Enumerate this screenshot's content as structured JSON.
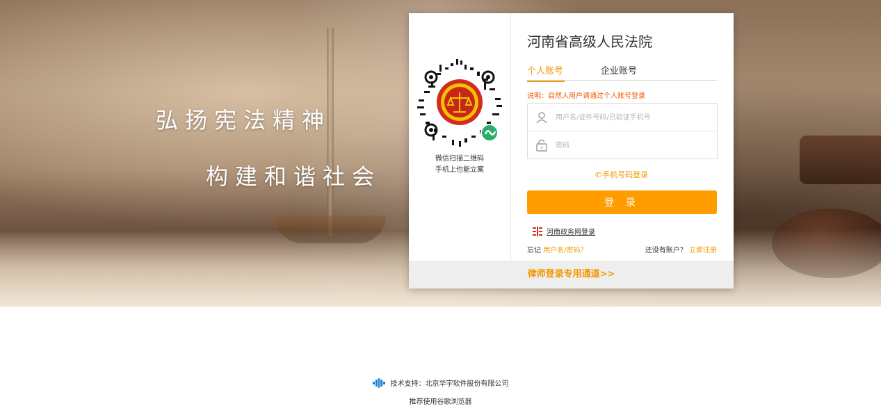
{
  "hero": {
    "slogan_line1": "弘扬宪法精神",
    "slogan_line2": "构建和谐社会"
  },
  "login_panel": {
    "court_name": "河南省高级人民法院",
    "qr": {
      "caption_line1": "微信扫描二维码",
      "caption_line2": "手机上也能立案",
      "icon": "wechat-miniprogram-qr-icon"
    },
    "tabs": [
      {
        "label": "个人账号",
        "active": true
      },
      {
        "label": "企业账号",
        "active": false
      }
    ],
    "notice": "说明：自然人用户请通过个人账号登录",
    "username": {
      "placeholder": "用户名/证件号码/已验证手机号",
      "value": "",
      "icon": "user-icon"
    },
    "password": {
      "placeholder": "密码",
      "value": "",
      "icon": "lock-icon"
    },
    "phone_login": "手机号码登录",
    "login_button": "登 录",
    "henan_gov_login": "河南政务网登录",
    "forgot_prefix": "忘记",
    "forgot_link": "用户名/密码？",
    "no_account_text": "还没有账户？",
    "register_link": "立即注册",
    "lawyer_channel": "律师登录专用通道>>"
  },
  "footer": {
    "support": "技术支持：北京华宇软件股份有限公司",
    "browser_tip": "推荐使用谷歌浏览器"
  },
  "colors": {
    "accent": "#f39800",
    "button": "#ff9c00",
    "notice": "#f05a00"
  }
}
